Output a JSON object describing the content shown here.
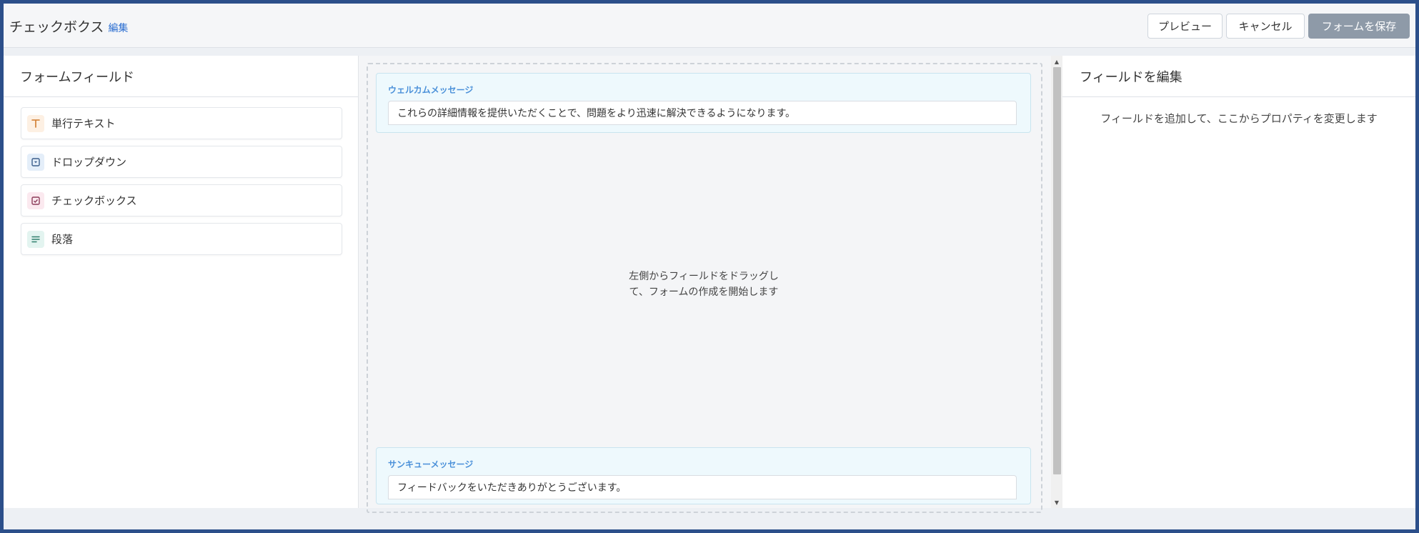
{
  "header": {
    "title": "チェックボクス",
    "edit_link": "編集",
    "buttons": {
      "preview": "プレビュー",
      "cancel": "キャンセル",
      "save": "フォームを保存"
    }
  },
  "left_panel": {
    "title": "フォームフィールド",
    "fields": [
      {
        "label": "単行テキスト",
        "icon": "text-type-icon"
      },
      {
        "label": "ドロップダウン",
        "icon": "dropdown-icon"
      },
      {
        "label": "チェックボックス",
        "icon": "checkbox-icon"
      },
      {
        "label": "段落",
        "icon": "paragraph-icon"
      }
    ]
  },
  "canvas": {
    "welcome": {
      "label": "ウェルカムメッセージ",
      "value": "これらの詳細情報を提供いただくことで、問題をより迅速に解決できるようになります。"
    },
    "drop_hint": "左側からフィールドをドラッグして、フォームの作成を開始します",
    "thanks": {
      "label": "サンキューメッセージ",
      "value": "フィードバックをいただきありがとうございます。"
    }
  },
  "right_panel": {
    "title": "フィールドを編集",
    "hint": "フィールドを追加して、ここからプロパティを変更します"
  },
  "colors": {
    "accent": "#4a90d9",
    "link": "#2d6fd1",
    "save_button": "#8e9aa8",
    "frame": "#2c4f8a"
  }
}
